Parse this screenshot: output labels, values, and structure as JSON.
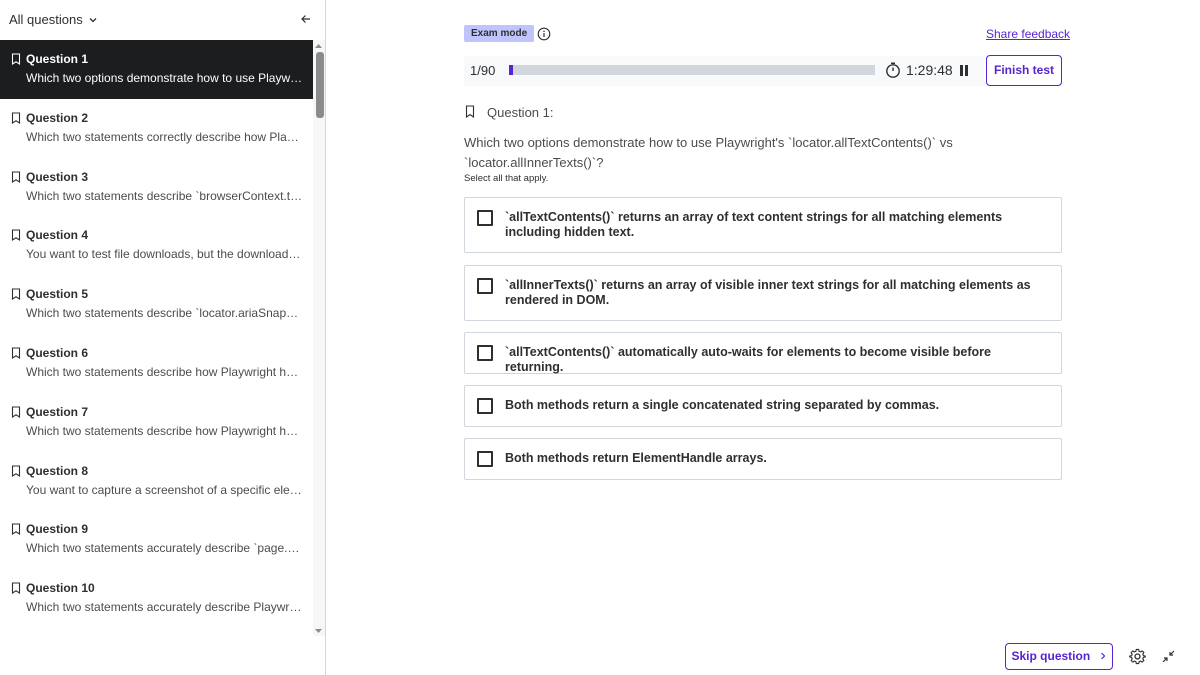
{
  "sidebar": {
    "title": "All questions",
    "title_icon": "chevron-down-icon",
    "collapse_icon": "arrow-left-icon",
    "questions": [
      {
        "title": "Question 1",
        "snippet": "Which two options demonstrate how to use Playwright'...",
        "active": true
      },
      {
        "title": "Question 2",
        "snippet": "Which two statements correctly describe how Playwrig...",
        "active": false
      },
      {
        "title": "Question 3",
        "snippet": "Which two statements describe `browserContext.tracin...",
        "active": false
      },
      {
        "title": "Question 4",
        "snippet": "You want to test file downloads, but the downloaded fil...",
        "active": false
      },
      {
        "title": "Question 5",
        "snippet": "Which two statements describe `locator.ariaSnapshot()...",
        "active": false
      },
      {
        "title": "Question 6",
        "snippet": "Which two statements describe how Playwright handle...",
        "active": false
      },
      {
        "title": "Question 7",
        "snippet": "Which two statements describe how Playwright handle...",
        "active": false
      },
      {
        "title": "Question 8",
        "snippet": "You want to capture a screenshot of a specific element ...",
        "active": false
      },
      {
        "title": "Question 9",
        "snippet": "Which two statements accurately describe `page.waitF...",
        "active": false
      },
      {
        "title": "Question 10",
        "snippet": "Which two statements accurately describe Playwright's...",
        "active": false
      }
    ]
  },
  "header": {
    "badge": "Exam mode",
    "info_icon": "info-icon",
    "share_feedback": "Share feedback"
  },
  "progress": {
    "count": "1/90",
    "fraction": 0.011,
    "timer": "1:29:48",
    "timer_icon": "stopwatch-icon",
    "pause_icon": "pause-icon",
    "finish_label": "Finish test"
  },
  "question": {
    "heading": "Question 1:",
    "text": "Which two options demonstrate how to use Playwright's `locator.allTextContents()` vs `locator.allInnerTexts()`?",
    "hint": "Select all that apply.",
    "options": [
      "`allTextContents()` returns an array of text content strings for all matching elements including hidden text.",
      "`allInnerTexts()` returns an array of visible inner text strings for all matching elements as rendered in DOM.",
      "`allTextContents()` automatically auto-waits for elements to become visible before returning.",
      "Both methods return a single concatenated string separated by commas.",
      "Both methods return ElementHandle arrays."
    ]
  },
  "footer": {
    "skip_label": "Skip question",
    "skip_icon": "chevron-right-icon",
    "settings_icon": "gear-icon",
    "exit_fullscreen_icon": "shrink-icon"
  },
  "colors": {
    "accent": "#5624d0",
    "active_bg": "#1c1d1f",
    "badge_bg": "#c0c4fc",
    "border": "#d1d7dc"
  }
}
